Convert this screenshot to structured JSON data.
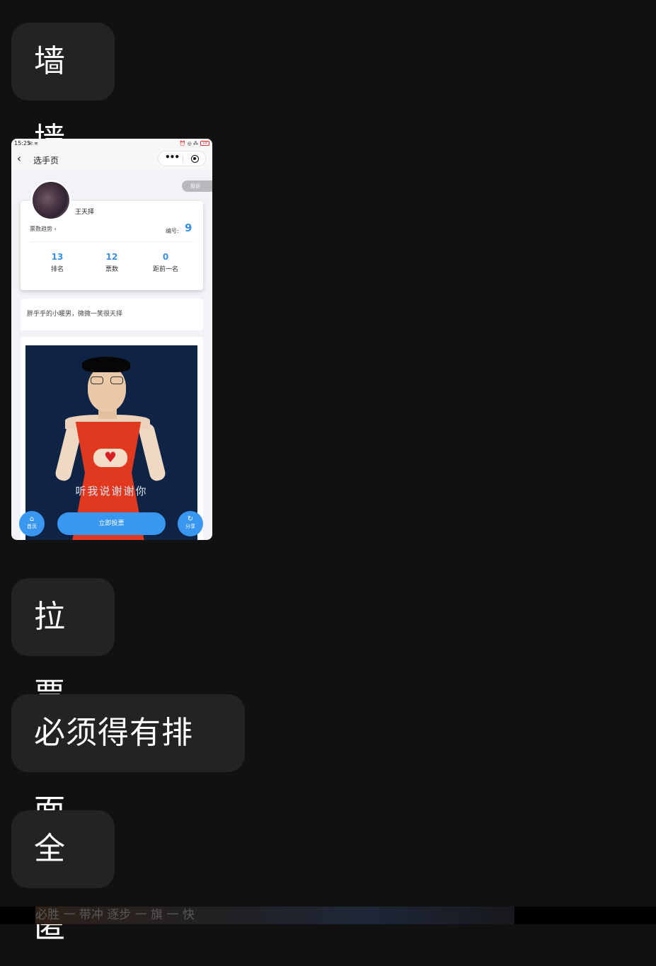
{
  "messages": [
    "墙墙",
    "拉票",
    "必须得有排面",
    "全匿"
  ],
  "phone": {
    "status_bar": {
      "time": "15:25",
      "battery": "19"
    },
    "nav": {
      "back_icon": "chevron-left-icon",
      "title": "选手页",
      "more_icon": "more-dots-icon",
      "close_icon": "target-circle-icon"
    },
    "complain_label": "投诉",
    "profile": {
      "name": "王天择",
      "trend_label": "票数趋势",
      "number_label": "编号:",
      "number_value": "9",
      "stats": [
        {
          "value": "13",
          "label": "排名"
        },
        {
          "value": "12",
          "label": "票数"
        },
        {
          "value": "0",
          "label": "距前一名"
        }
      ]
    },
    "description": "胖乎乎的小暖男，微微一笑很天择",
    "photo_caption": "听我说谢谢你",
    "bottom_bar": {
      "home_label": "首页",
      "vote_label": "立即投票",
      "share_label": "分享"
    }
  },
  "bottom_strip_text": "必胜 一 带冲 逐步 一 旗 一 快",
  "colors": {
    "background": "#111111",
    "bubble": "#222322",
    "accent": "#3a97f0",
    "number": "#3a8fe0"
  }
}
